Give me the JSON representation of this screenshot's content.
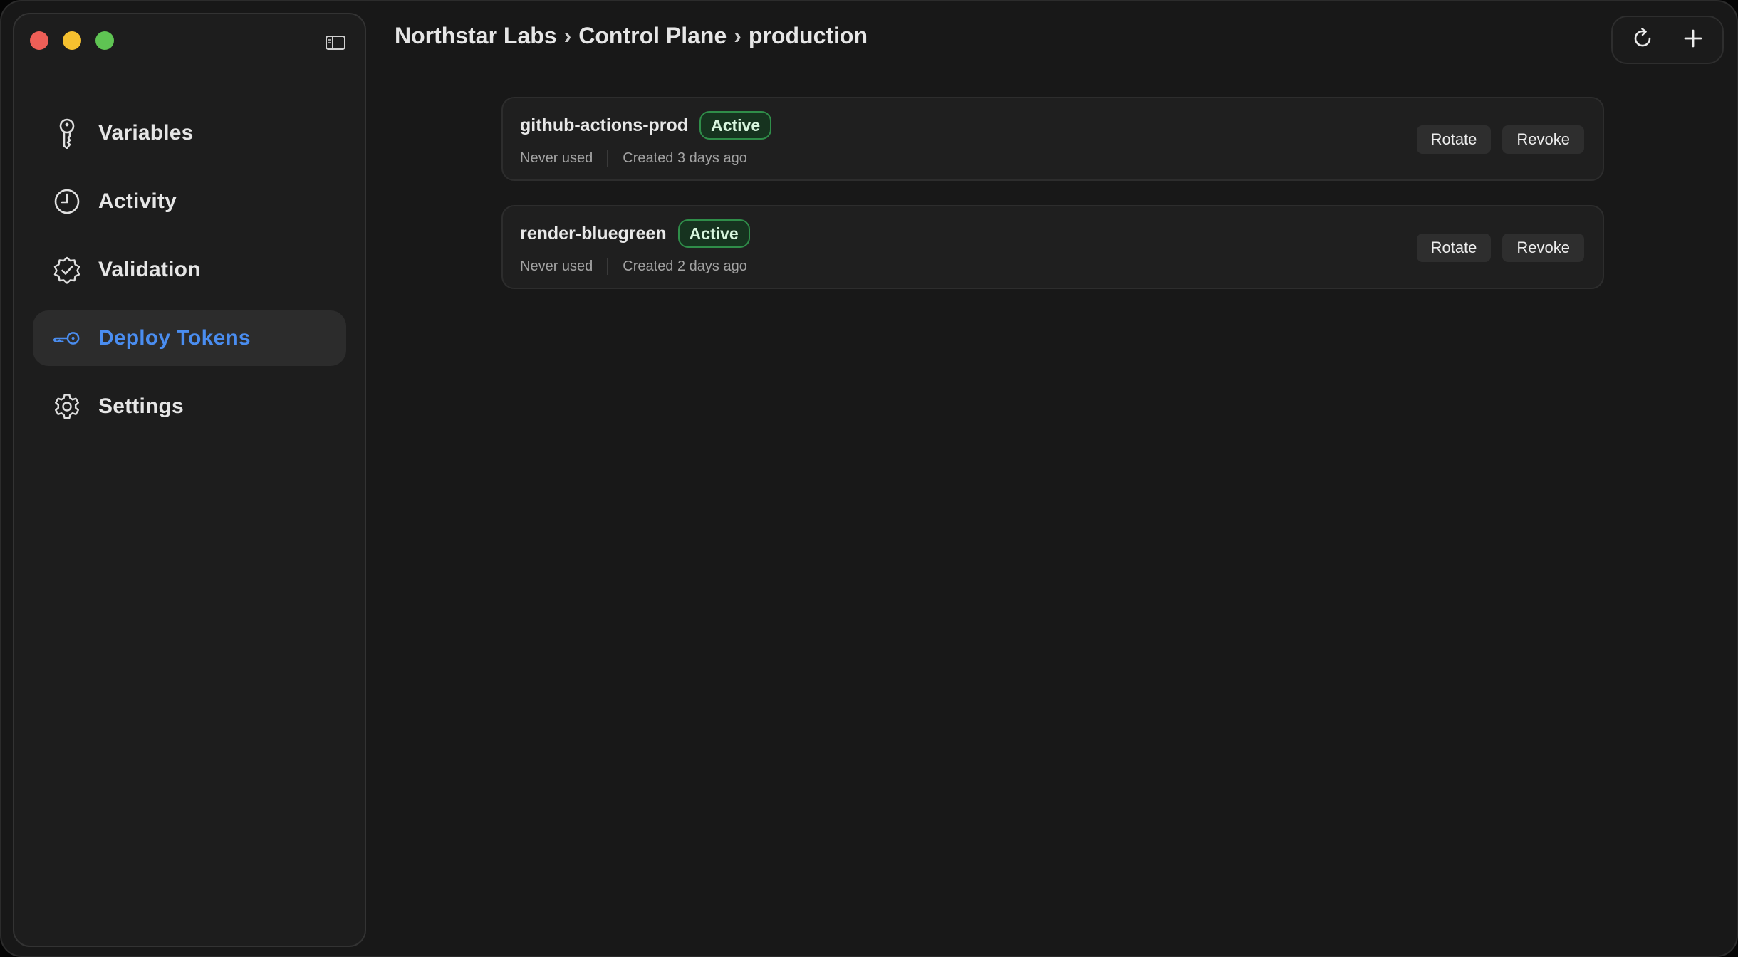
{
  "window": {
    "traffic_lights": [
      "close",
      "minimize",
      "maximize"
    ]
  },
  "sidebar": {
    "toggle_icon": "sidebar-toggle-icon",
    "items": [
      {
        "label": "Variables",
        "icon": "key-icon",
        "active": false
      },
      {
        "label": "Activity",
        "icon": "clock-icon",
        "active": false
      },
      {
        "label": "Validation",
        "icon": "badge-check-icon",
        "active": false
      },
      {
        "label": "Deploy Tokens",
        "icon": "deploy-key-icon",
        "active": true
      },
      {
        "label": "Settings",
        "icon": "gear-icon",
        "active": false
      }
    ]
  },
  "header": {
    "breadcrumb": [
      "Northstar Labs",
      "Control Plane",
      "production"
    ],
    "separator": "›",
    "actions": [
      {
        "icon": "refresh-icon"
      },
      {
        "icon": "plus-icon"
      }
    ]
  },
  "tokens": [
    {
      "name": "github-actions-prod",
      "status": "Active",
      "last_used": "Never used",
      "created": "Created 3 days ago",
      "rotate_label": "Rotate",
      "revoke_label": "Revoke"
    },
    {
      "name": "render-bluegreen",
      "status": "Active",
      "last_used": "Never used",
      "created": "Created 2 days ago",
      "rotate_label": "Rotate",
      "revoke_label": "Revoke"
    }
  ],
  "colors": {
    "accent": "#4a8df0",
    "status_active_border": "#2f8d49",
    "status_active_bg": "#16331f"
  }
}
